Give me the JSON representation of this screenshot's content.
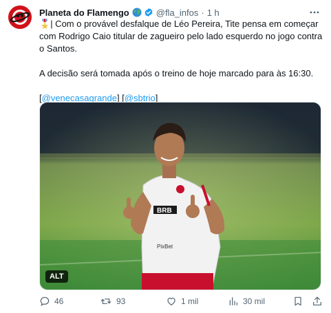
{
  "author": {
    "display_name": "Planeta do Flamengo",
    "handle": "@fla_infos",
    "separator": "·",
    "time": "1 h"
  },
  "tweet": {
    "line1_emoji": "🎖️",
    "para1": "| Com o provável desfalque de Léo Pereira, Tite pensa em começar com Rodrigo Caio titular de zagueiro pelo lado esquerdo no jogo contra o Santos.",
    "para2": "A decisão será tomada após o treino de hoje marcado para às 16:30.",
    "credit_open": "[",
    "credit_link1": "@venecasagrande",
    "credit_mid": "] [",
    "credit_link2": "@sbtrio",
    "credit_close": "]"
  },
  "media": {
    "alt_label": "ALT",
    "shirt_sponsor": "PixBet",
    "shirt_text2": "BRB"
  },
  "actions": {
    "replies": "46",
    "retweets": "93",
    "likes": "1 mil",
    "views": "30 mil"
  },
  "colors": {
    "accent": "#1d9bf0",
    "muted": "#536471",
    "avatar_red": "#d0121b"
  },
  "icons": {
    "avatar": "avatar-icon",
    "globe": "globe-icon",
    "verified": "verified-badge-icon",
    "more": "more-icon",
    "reply": "reply-icon",
    "retweet": "retweet-icon",
    "like": "heart-icon",
    "views": "views-icon",
    "bookmark": "bookmark-icon",
    "share": "share-icon"
  }
}
